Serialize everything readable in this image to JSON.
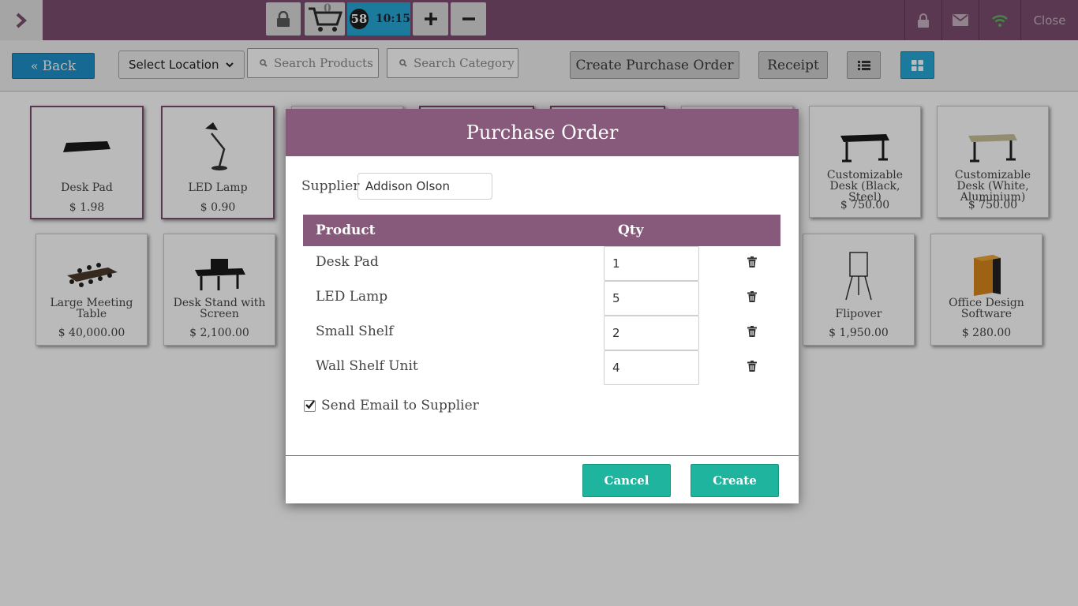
{
  "topbar": {
    "cart_count": "0",
    "order_number": "58",
    "order_time": "10:15",
    "close_label": "Close"
  },
  "controls": {
    "back_label": "Back",
    "location_label": "Select Location",
    "search_products_placeholder": "Search Products",
    "search_category_placeholder": "Search Category",
    "create_po_label": "Create Purchase Order",
    "receipt_label": "Receipt"
  },
  "products": [
    {
      "name": "Desk Pad",
      "price": "$ 1.98"
    },
    {
      "name": "LED Lamp",
      "price": "$ 0.90"
    },
    {
      "name": "Customizable Desk (Black, Steel)",
      "price": "$ 750.00"
    },
    {
      "name": "Customizable Desk (White, Aluminium)",
      "price": "$ 750.00"
    },
    {
      "name": "Large Meeting Table",
      "price": "$ 40,000.00"
    },
    {
      "name": "Desk Stand with Screen",
      "price": "$ 2,100.00"
    },
    {
      "name": "Flipover",
      "price": "$ 1,950.00"
    },
    {
      "name": "Office Design Software",
      "price": "$ 280.00"
    }
  ],
  "modal": {
    "title": "Purchase Order",
    "supplier_label": "Supplier",
    "supplier_value": "Addison Olson",
    "col_product": "Product",
    "col_qty": "Qty",
    "lines": [
      {
        "product": "Desk Pad",
        "qty": "1"
      },
      {
        "product": "LED Lamp",
        "qty": "5"
      },
      {
        "product": "Small Shelf",
        "qty": "2"
      },
      {
        "product": "Wall Shelf Unit",
        "qty": "4"
      }
    ],
    "send_email_label": "Send Email to Supplier",
    "send_email_checked": true,
    "cancel_label": "Cancel",
    "create_label": "Create"
  },
  "colors": {
    "brand_purple": "#875a7b",
    "accent_blue": "#27a8d6",
    "teal": "#1fb49e"
  }
}
